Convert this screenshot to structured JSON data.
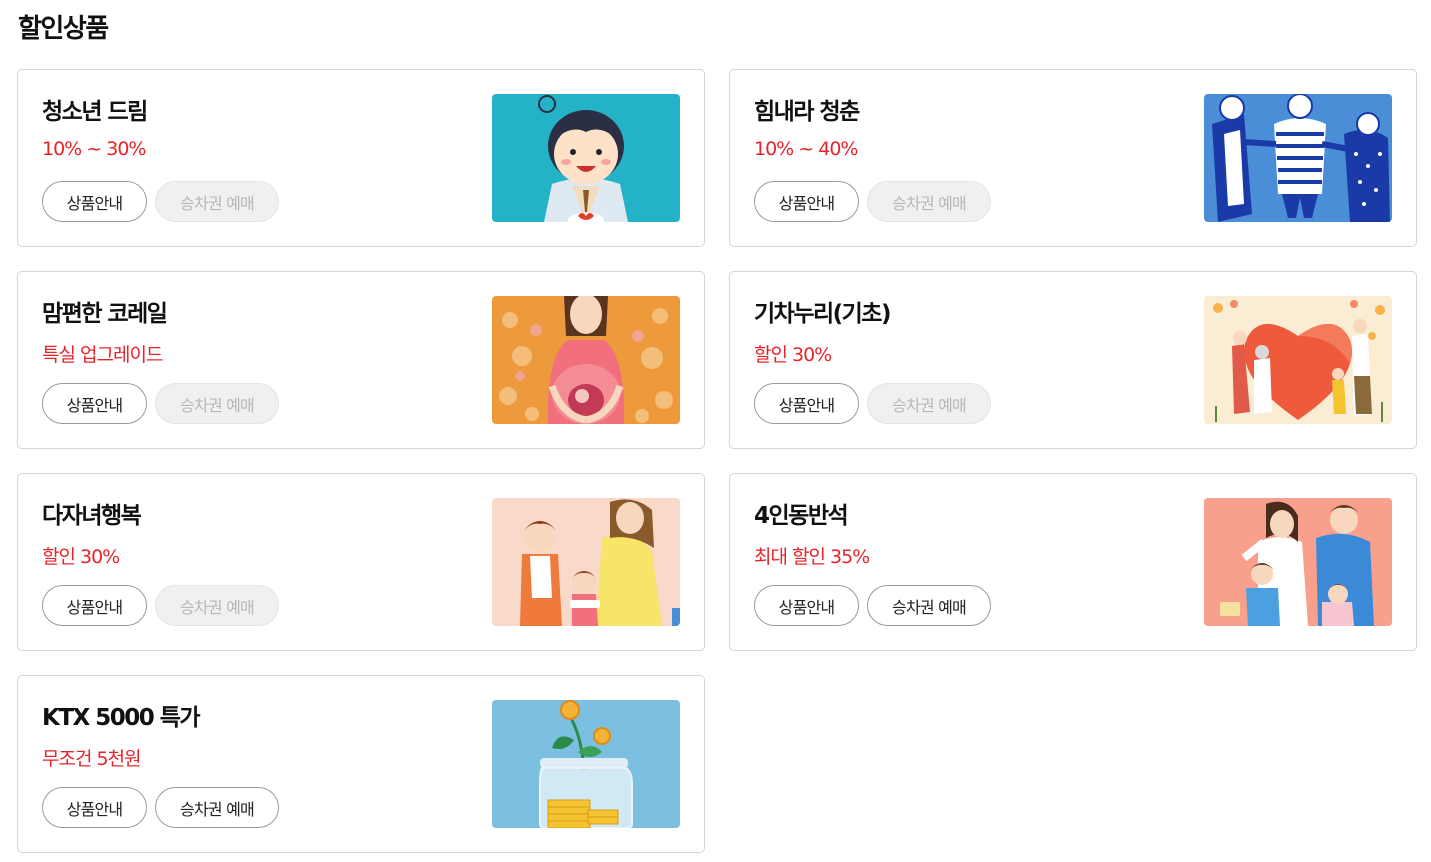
{
  "page": {
    "title": "할인상품"
  },
  "buttons": {
    "info": "상품안내",
    "book": "승차권 예매"
  },
  "colors": {
    "accent": "#e8242b",
    "border": "#d6d6d6"
  },
  "cards": [
    {
      "title": "청소년 드림",
      "discount": "10% ~ 30%",
      "booking_enabled": false,
      "illustration": "teen-boy-illustration"
    },
    {
      "title": "힘내라 청춘",
      "discount": "10% ~ 40%",
      "booking_enabled": false,
      "illustration": "young-friends-illustration"
    },
    {
      "title": "맘편한 코레일",
      "discount": "특실 업그레이드",
      "booking_enabled": false,
      "illustration": "pregnant-mother-illustration"
    },
    {
      "title": "기차누리(기초)",
      "discount": "할인 30%",
      "booking_enabled": false,
      "illustration": "heart-family-illustration"
    },
    {
      "title": "다자녀행복",
      "discount": "할인 30%",
      "booking_enabled": false,
      "illustration": "multi-child-family-illustration"
    },
    {
      "title": "4인동반석",
      "discount": "최대 할인 35%",
      "booking_enabled": true,
      "illustration": "family-of-four-illustration"
    },
    {
      "title": "KTX 5000 특가",
      "discount": "무조건 5천원",
      "booking_enabled": true,
      "illustration": "coin-jar-illustration"
    }
  ]
}
